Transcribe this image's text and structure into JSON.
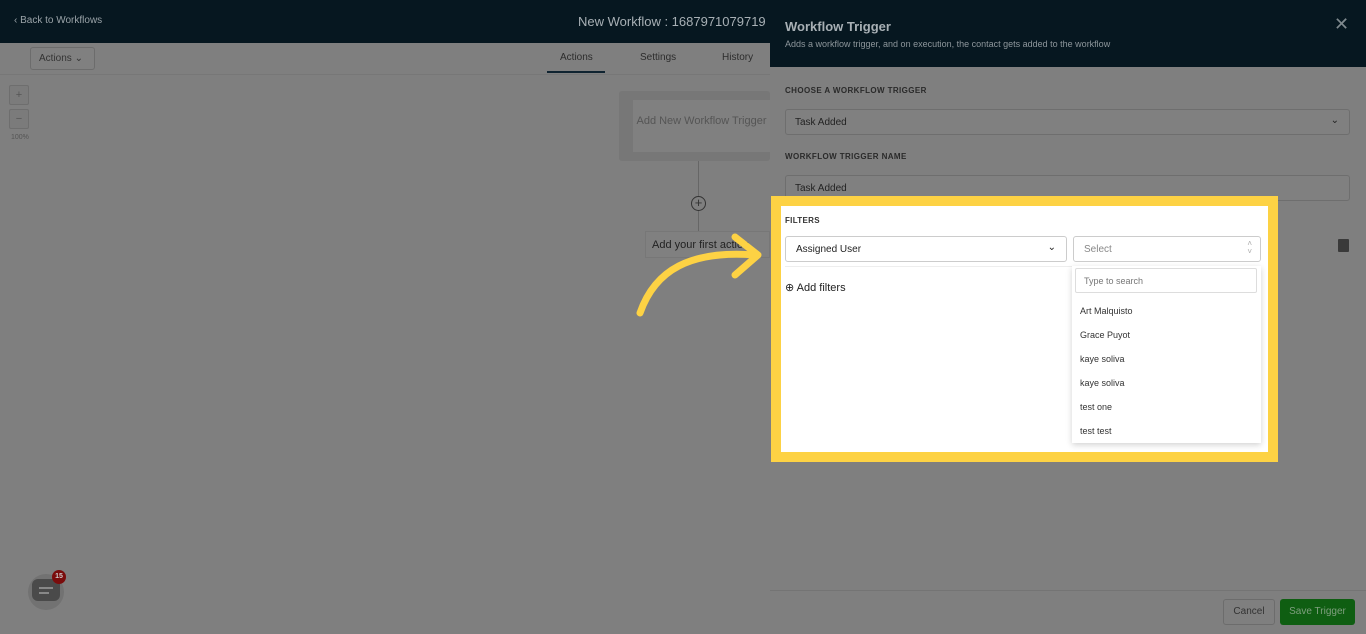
{
  "header": {
    "back": "‹ Back to Workflows",
    "title": "New Workflow : 1687971079719"
  },
  "toolbar": {
    "actions": "Actions ⌄",
    "tabs": [
      "Actions",
      "Settings",
      "History"
    ]
  },
  "zoom": {
    "plus": "+",
    "minus": "−",
    "level": "100%"
  },
  "canvas": {
    "trigger_card": "Add New Workflow Trigger",
    "add_icon": "+",
    "first_action": "Add your first action"
  },
  "panel": {
    "title": "Workflow Trigger",
    "subtitle": "Adds a workflow trigger, and on execution, the contact gets added to the workflow",
    "close": "✕",
    "choose_label": "CHOOSE A WORKFLOW TRIGGER",
    "choose_value": "Task Added",
    "name_label": "WORKFLOW TRIGGER NAME",
    "name_value": "Task Added",
    "filters_label": "FILTERS",
    "filter_field": "Assigned User",
    "filter_value_placeholder": "Select",
    "search_placeholder": "Type to search",
    "options": [
      "Art Malquisto",
      "Grace Puyot",
      "kaye soliva",
      "kaye soliva",
      "test one",
      "test test"
    ],
    "add_filters": "Add filters",
    "cancel": "Cancel",
    "save": "Save Trigger"
  },
  "chat": {
    "badge": "15"
  },
  "colors": {
    "highlight": "#fdd244",
    "header": "#061720",
    "save": "#0f5e12"
  }
}
